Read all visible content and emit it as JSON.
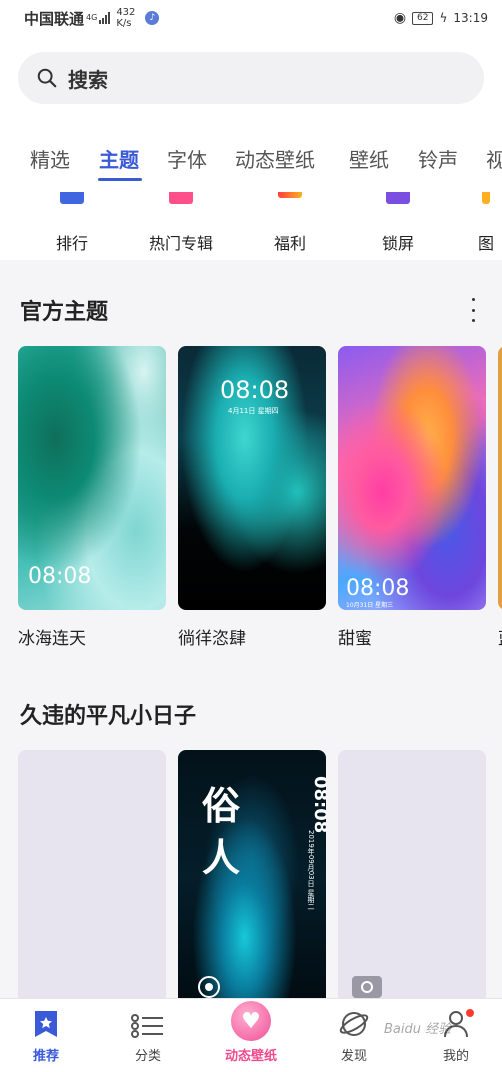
{
  "status_bar": {
    "carrier": "中国联通",
    "network": "4G",
    "speed_value": "432",
    "speed_unit": "K/s",
    "battery": "62",
    "time": "13:19"
  },
  "search": {
    "placeholder": "搜索"
  },
  "tabs": [
    "精选",
    "主题",
    "字体",
    "动态壁纸",
    "壁纸",
    "铃声",
    "视"
  ],
  "active_tab": "主题",
  "quick_links": [
    {
      "label": "排行",
      "color": "#3f66e0"
    },
    {
      "label": "热门专辑",
      "color": "#ff4f8b"
    },
    {
      "label": "福利",
      "color": "#ff7a1a"
    },
    {
      "label": "锁屏",
      "color": "#7a4ee0"
    },
    {
      "label": "图",
      "color": "#ffb020"
    }
  ],
  "official_section": {
    "title": "官方主题",
    "items": [
      {
        "name": "冰海连天",
        "time": "08:08"
      },
      {
        "name": "徜徉恣肆",
        "time": "08:08",
        "date": "4月11日 星期四"
      },
      {
        "name": "甜蜜",
        "time": "08:08",
        "date": "10月31日 星期三"
      },
      {
        "name": "蓝"
      }
    ]
  },
  "section2": {
    "title": "久违的平凡小日子",
    "items": [
      {},
      {
        "vertical_text": "俗人",
        "time": "08:08",
        "date": "2019年09月03日 星期二"
      },
      {}
    ]
  },
  "bottom_nav": [
    {
      "label": "推荐",
      "icon": "star-bookmark-icon",
      "active": true
    },
    {
      "label": "分类",
      "icon": "list-icon"
    },
    {
      "label": "动态壁纸",
      "icon": "heart-icon"
    },
    {
      "label": "发现",
      "icon": "planet-icon"
    },
    {
      "label": "我的",
      "icon": "user-icon"
    }
  ],
  "watermark": "Baidu 经验",
  "colors": {
    "accent": "#3a5ad8",
    "pink": "#ef4a8c"
  }
}
